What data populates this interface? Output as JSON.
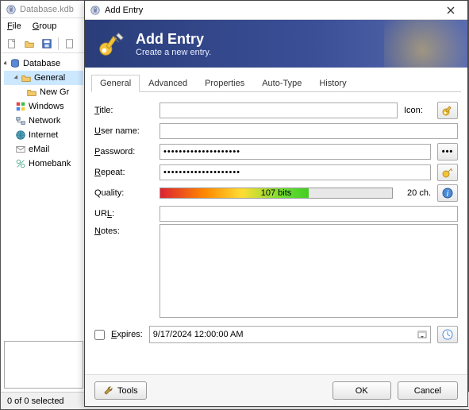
{
  "parent": {
    "title": "Database.kdb",
    "menu": {
      "file": "File",
      "group": "Group"
    },
    "tree": {
      "root": "Database",
      "items": [
        {
          "label": "General",
          "selected": true
        },
        {
          "label": "New Gr"
        },
        {
          "label": "Windows"
        },
        {
          "label": "Network"
        },
        {
          "label": "Internet"
        },
        {
          "label": "eMail"
        },
        {
          "label": "Homebank"
        }
      ]
    },
    "status": "0 of 0 selected"
  },
  "dialog": {
    "title": "Add Entry",
    "header": {
      "title": "Add Entry",
      "subtitle": "Create a new entry."
    },
    "tabs": [
      "General",
      "Advanced",
      "Properties",
      "Auto-Type",
      "History"
    ],
    "labels": {
      "title": "Title:",
      "icon": "Icon:",
      "username": "User name:",
      "password": "Password:",
      "repeat": "Repeat:",
      "quality": "Quality:",
      "url": "URL:",
      "notes": "Notes:",
      "expires": "Expires:"
    },
    "values": {
      "title": "",
      "username": "",
      "password": "••••••••••••••••••••",
      "repeat": "••••••••••••••••••••",
      "quality_text": "107 bits",
      "chars": "20 ch.",
      "url": "",
      "notes": "",
      "expires_date": "9/17/2024 12:00:00 AM",
      "expires_checked": false
    },
    "buttons": {
      "tools": "Tools",
      "ok": "OK",
      "cancel": "Cancel"
    }
  }
}
